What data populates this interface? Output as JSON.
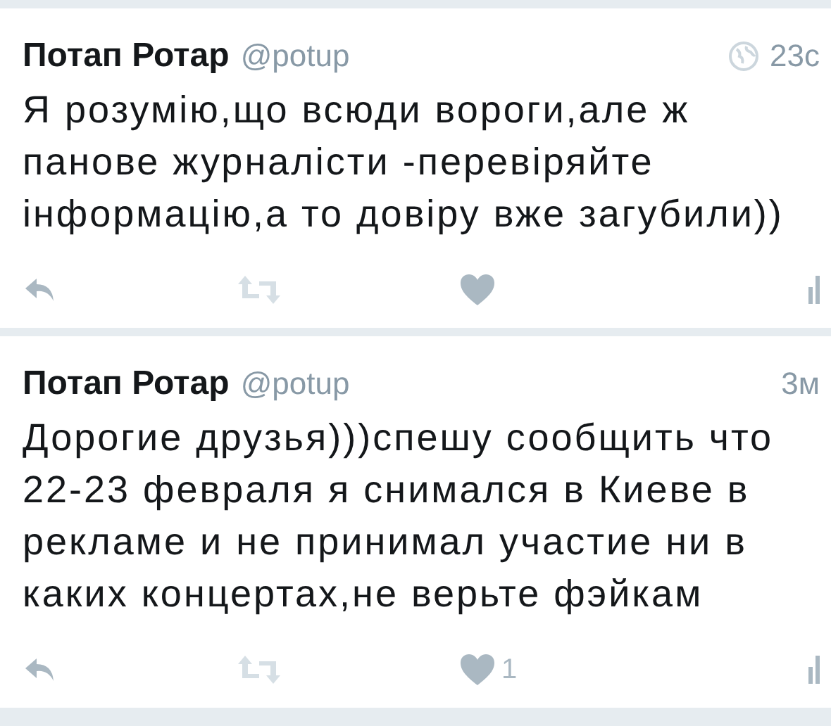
{
  "tweets": [
    {
      "name": "Потап Ротар",
      "handle": "@potup",
      "time": "23с",
      "globe": true,
      "text": "Я розумію,що всюди вороги,але ж панове журналісти -перевіряйте інформацію,а то довіру вже загубили))"
    },
    {
      "name": "Потап Ротар",
      "handle": "@potup",
      "time": "3м",
      "globe": false,
      "text": "Дорогие друзья)))спешу сообщить что 22-23 февраля я снимался в Киеве в рекламе и не принимал участие ни в каких концертах,не верьте фэйкам",
      "like_count": "1"
    }
  ]
}
